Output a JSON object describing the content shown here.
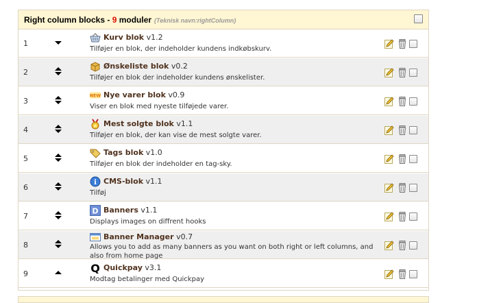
{
  "header": {
    "title": "Right column blocks",
    "separator": " - ",
    "count": "9",
    "count_label": " moduler",
    "technical": "(Teknisk navn:rightColumn)"
  },
  "rows": [
    {
      "position": "1",
      "name": "Kurv blok",
      "version": "v1.2",
      "description": "Tilføjer en blok, der indeholder kundens indkøbskurv.",
      "icon": "shopping-basket-icon",
      "arrows": "down"
    },
    {
      "position": "2",
      "name": "Ønskeliste blok",
      "version": "v0.2",
      "description": "Tilføjer en blok der indeholder kundens ønskelister.",
      "icon": "gift-box-icon",
      "arrows": "both"
    },
    {
      "position": "3",
      "name": "Nye varer blok",
      "version": "v0.9",
      "description": "Viser en blok med nyeste tilføjede varer.",
      "icon": "new-badge-icon",
      "arrows": "both"
    },
    {
      "position": "4",
      "name": "Mest solgte blok",
      "version": "v1.1",
      "description": "Tilføjer en blok, der kan vise de mest solgte varer.",
      "icon": "medal-icon",
      "arrows": "both"
    },
    {
      "position": "5",
      "name": "Tags blok",
      "version": "v1.0",
      "description": "Tilføjer en blok der indeholder en tag-sky.",
      "icon": "tag-icon",
      "arrows": "both"
    },
    {
      "position": "6",
      "name": "CMS-blok",
      "version": "v1.1",
      "description": "Tilføj",
      "icon": "info-icon",
      "arrows": "both"
    },
    {
      "position": "7",
      "name": "Banners",
      "version": "v1.1",
      "description": "Displays images on diffrent hooks",
      "icon": "d-letter-icon",
      "arrows": "both"
    },
    {
      "position": "8",
      "name": "Banner Manager",
      "version": "v0.7",
      "description": "Allows you to add as many banners as you want on both right or left columns, and also from home page",
      "icon": "window-icon",
      "arrows": "both"
    },
    {
      "position": "9",
      "name": "Quickpay",
      "version": "v3.1",
      "description": "Modtag betalinger med Quickpay",
      "icon": "q-letter-icon",
      "arrows": "up"
    }
  ],
  "icon_glyphs": {
    "new_badge_text": "NEW",
    "d_letter": "D",
    "q_letter": "Q",
    "info_letter": "i"
  },
  "colors": {
    "header_bg": "#fff6d3",
    "border": "#dfd5c3",
    "count_red": "#da0f00",
    "module_name": "#50321e",
    "alt_row_bg": "#efefef"
  }
}
